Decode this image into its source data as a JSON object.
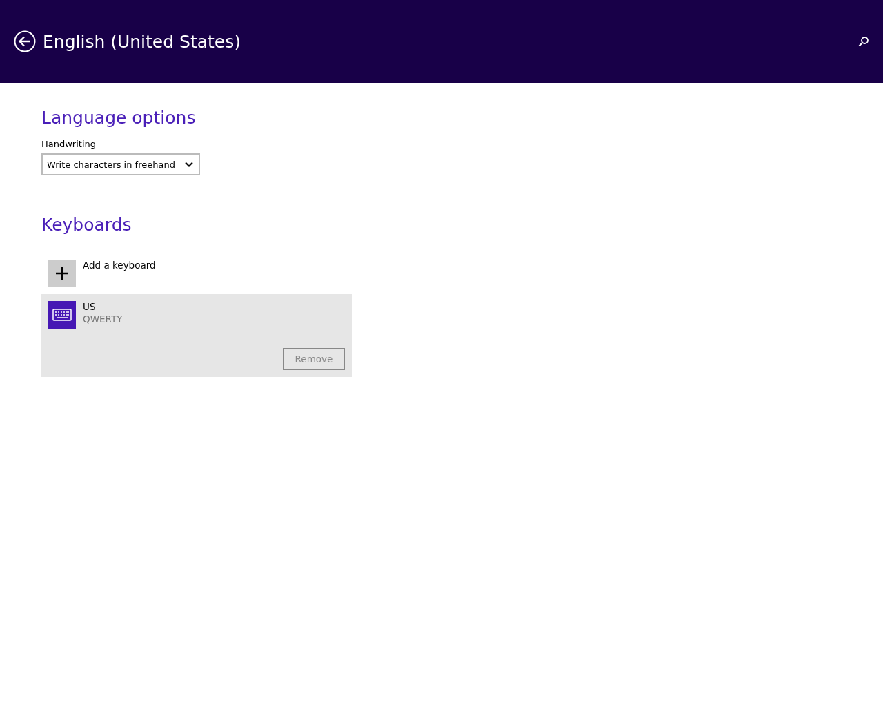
{
  "header": {
    "title": "English (United States)"
  },
  "language_options": {
    "title": "Language options",
    "handwriting": {
      "label": "Handwriting",
      "value": "Write characters in freehand"
    }
  },
  "keyboards": {
    "title": "Keyboards",
    "add_label": "Add a keyboard",
    "items": [
      {
        "name": "US",
        "layout": "QWERTY",
        "selected": true,
        "remove": {
          "label": "Remove",
          "disabled": true
        }
      }
    ]
  }
}
